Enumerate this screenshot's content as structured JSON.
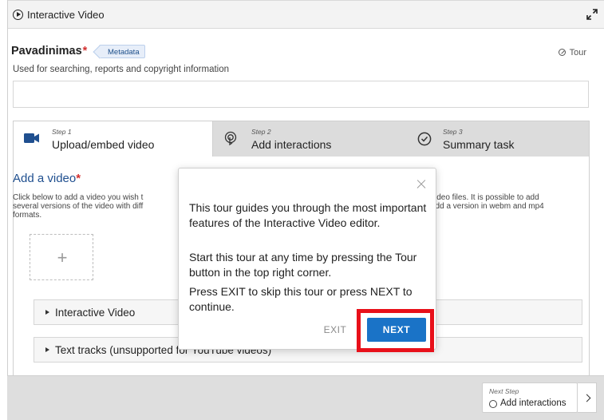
{
  "window": {
    "title": "Interactive Video"
  },
  "header": {
    "field_label": "Pavadinimas",
    "required_mark": "*",
    "metadata_badge": "Metadata",
    "tour_link": "Tour",
    "description": "Used for searching, reports and copyright information",
    "title_input_value": ""
  },
  "steps": [
    {
      "number": "Step 1",
      "label": "Upload/embed video",
      "icon": "video-camera-icon",
      "active": true
    },
    {
      "number": "Step 2",
      "label": "Add interactions",
      "icon": "tap-icon",
      "active": false
    },
    {
      "number": "Step 3",
      "label": "Summary task",
      "icon": "check-circle-icon",
      "active": false
    }
  ],
  "content": {
    "add_video_label": "Add a video",
    "required_mark": "*",
    "desc_left": "Click below to add a video you wish to use in your interactive video. You can add a video link or upload video files. It is possible to add several versions of the video with different qualities. To ensure maximum support in browsers at least add a version in webm and mp4 formats.",
    "desc_left_visible_1": "Click below to add a video you wish t",
    "desc_left_visible_2": "several versions of the video with diff",
    "desc_left_visible_3": "formats.",
    "desc_right_visible_1": "video files. It is possible to add",
    "desc_right_visible_2": "add a version in webm and mp4",
    "upload_plus": "+",
    "groups": [
      {
        "label": "Interactive Video"
      },
      {
        "label": "Text tracks (unsupported for YouTube videos)"
      }
    ]
  },
  "footer": {
    "next_step_caption": "Next Step",
    "next_step_label": "Add interactions"
  },
  "tour_popover": {
    "paragraph_1": "This tour guides you through the most important features of the Interactive Video editor.",
    "paragraph_2": "Start this tour at any time by pressing the Tour button in the top right corner.",
    "paragraph_3": "Press EXIT to skip this tour or press NEXT to continue.",
    "exit_label": "EXIT",
    "next_label": "NEXT"
  },
  "colors": {
    "accent_blue": "#1a73c7",
    "required_red": "#d32f2f",
    "highlight_red": "#e8101a",
    "heading_blue": "#1f4f8f"
  }
}
